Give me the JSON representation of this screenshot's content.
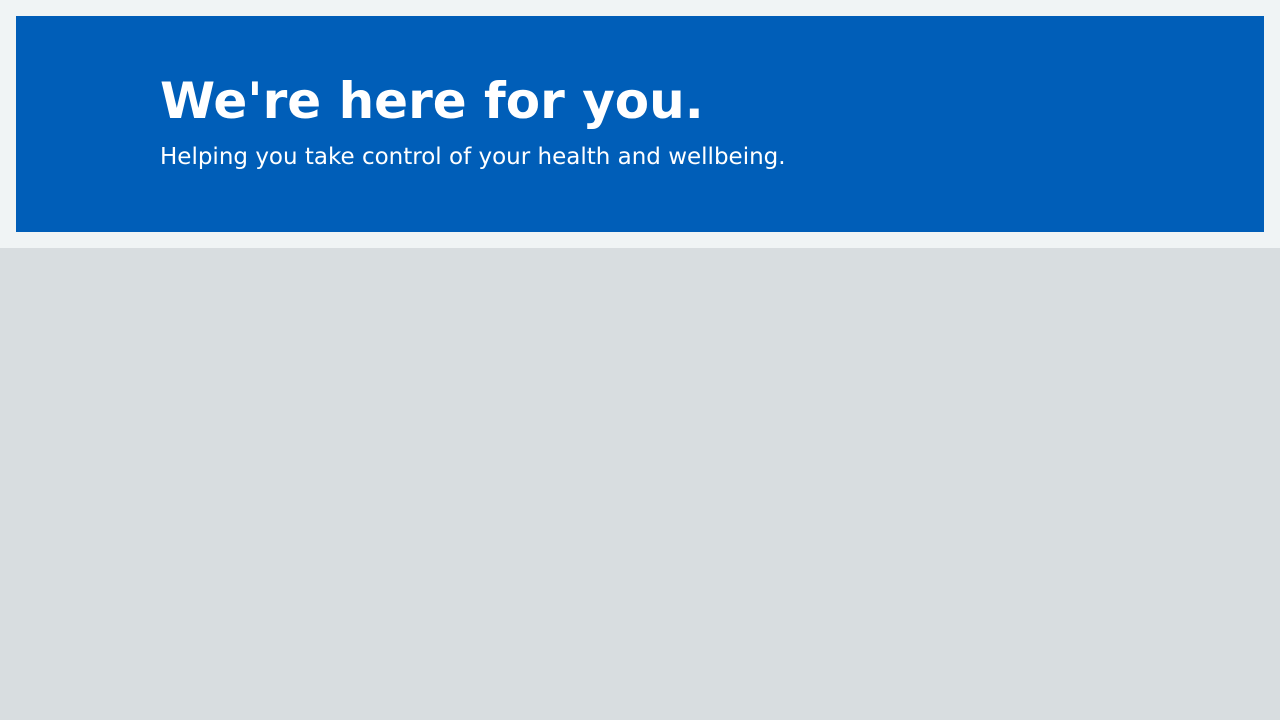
{
  "hero": {
    "title": "We're here for you.",
    "subtitle": "Helping you take control of your health and wellbeing.",
    "background_color": "#005eb8",
    "text_color": "#ffffff"
  },
  "page": {
    "band_color": "#f0f4f5",
    "body_color": "#d8dde0"
  }
}
